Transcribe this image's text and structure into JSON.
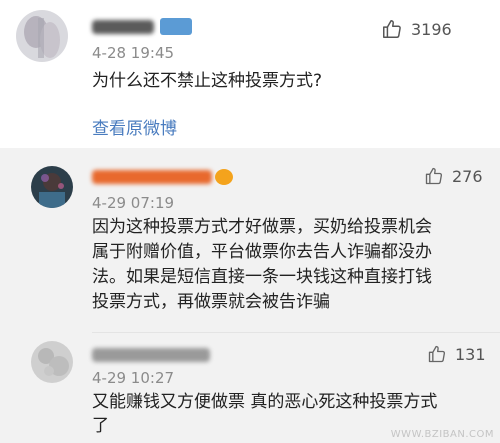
{
  "post": {
    "time": "4-28 19:45",
    "likes": "3196",
    "content": "为什么还不禁止这种投票方式?",
    "view_original": "查看原微博",
    "avatar_icon": "user-avatar-icon",
    "like_icon": "thumbs-up-icon",
    "badge_color": "#5b9bd5"
  },
  "replies": [
    {
      "time": "4-29 07:19",
      "likes": "276",
      "lines": [
        "因为这种投票方式才好做票，买奶给投票机会",
        "属于附赠价值，平台做票你去告人诈骗都没办",
        "法。如果是短信直接一条一块钱这种直接打钱",
        "投票方式，再做票就会被告诈骗"
      ],
      "name_color": "#e8692d",
      "badge_color": "#f4a31c"
    },
    {
      "time": "4-29 10:27",
      "likes": "131",
      "lines": [
        "又能赚钱又方便做票 真的恶心死这种投票方式",
        "了"
      ],
      "name_color": "#9a9a9a"
    }
  ],
  "watermark": "WWW.BZIBAN.COM"
}
